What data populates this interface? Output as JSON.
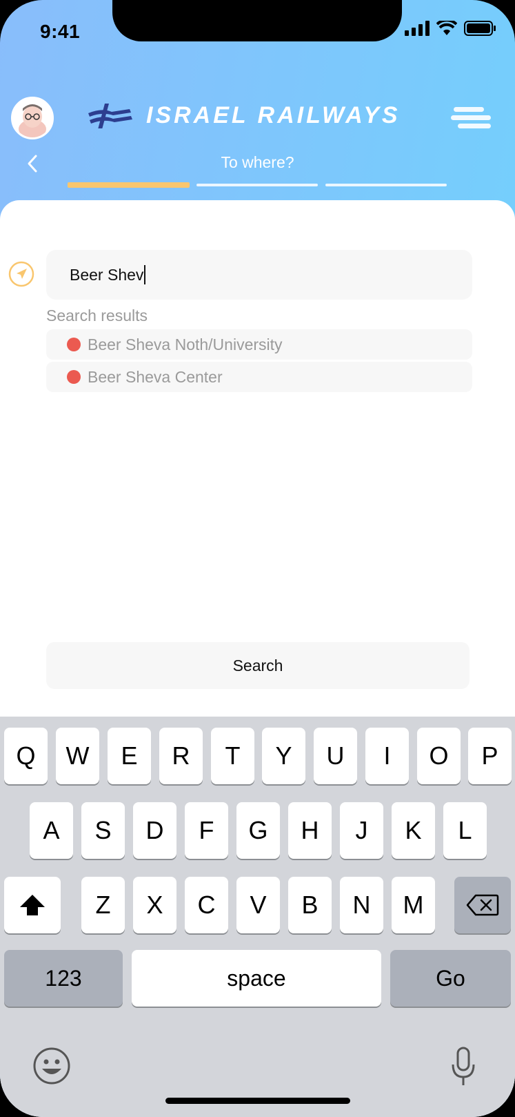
{
  "status_bar": {
    "time": "9:41"
  },
  "header": {
    "brand": "ISRAEL RAILWAYS",
    "step_title": "To where?",
    "steps_total": 3,
    "current_step": 1
  },
  "search": {
    "value": "Beer Shev",
    "results_label": "Search results",
    "results": [
      {
        "label": "Beer Sheva Noth/University"
      },
      {
        "label": "Beer Sheva Center"
      }
    ],
    "button_label": "Search"
  },
  "keyboard": {
    "row1": [
      "Q",
      "W",
      "E",
      "R",
      "T",
      "Y",
      "U",
      "I",
      "O",
      "P"
    ],
    "row2": [
      "A",
      "S",
      "D",
      "F",
      "G",
      "H",
      "J",
      "K",
      "L"
    ],
    "row3": [
      "Z",
      "X",
      "C",
      "V",
      "B",
      "N",
      "M"
    ],
    "numbers_label": "123",
    "space_label": "space",
    "go_label": "Go"
  },
  "colors": {
    "accent_progress": "#f9c66e",
    "pin_red": "#eb5a50",
    "header_gradient_start": "#89bdfb",
    "header_gradient_end": "#6fd3fd"
  },
  "icons": {
    "status": [
      "cellular-signal-icon",
      "wifi-icon",
      "battery-icon"
    ],
    "header": [
      "avatar",
      "railways-logo-icon",
      "menu-icon",
      "back-chevron-icon"
    ],
    "search": "location-arrow-icon",
    "keyboard": [
      "shift-icon",
      "delete-icon",
      "emoji-icon",
      "microphone-icon"
    ]
  }
}
